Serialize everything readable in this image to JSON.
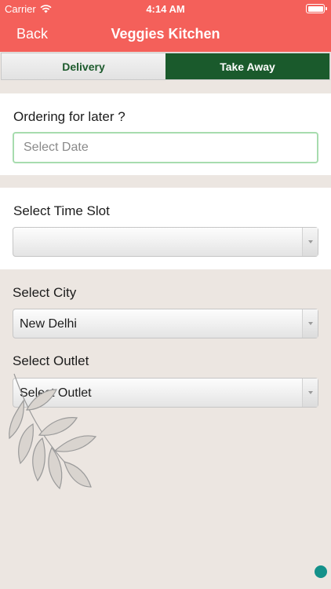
{
  "status_bar": {
    "carrier": "Carrier",
    "time": "4:14 AM"
  },
  "nav": {
    "back_label": "Back",
    "title": "Veggies Kitchen"
  },
  "tabs": [
    {
      "label": "Delivery",
      "selected": false
    },
    {
      "label": "Take Away",
      "selected": true
    }
  ],
  "order_later": {
    "label": "Ordering for later ?",
    "placeholder": "Select Date",
    "value": ""
  },
  "time_slot": {
    "label": "Select Time Slot",
    "value": ""
  },
  "city": {
    "label": "Select City",
    "value": "New Delhi"
  },
  "outlet": {
    "label": "Select Outlet",
    "value": "Select Outlet"
  },
  "colors": {
    "brand": "#f4605a",
    "tab_active": "#1a5a2c",
    "focus_border": "#a7dcae",
    "fab": "#14918a"
  }
}
